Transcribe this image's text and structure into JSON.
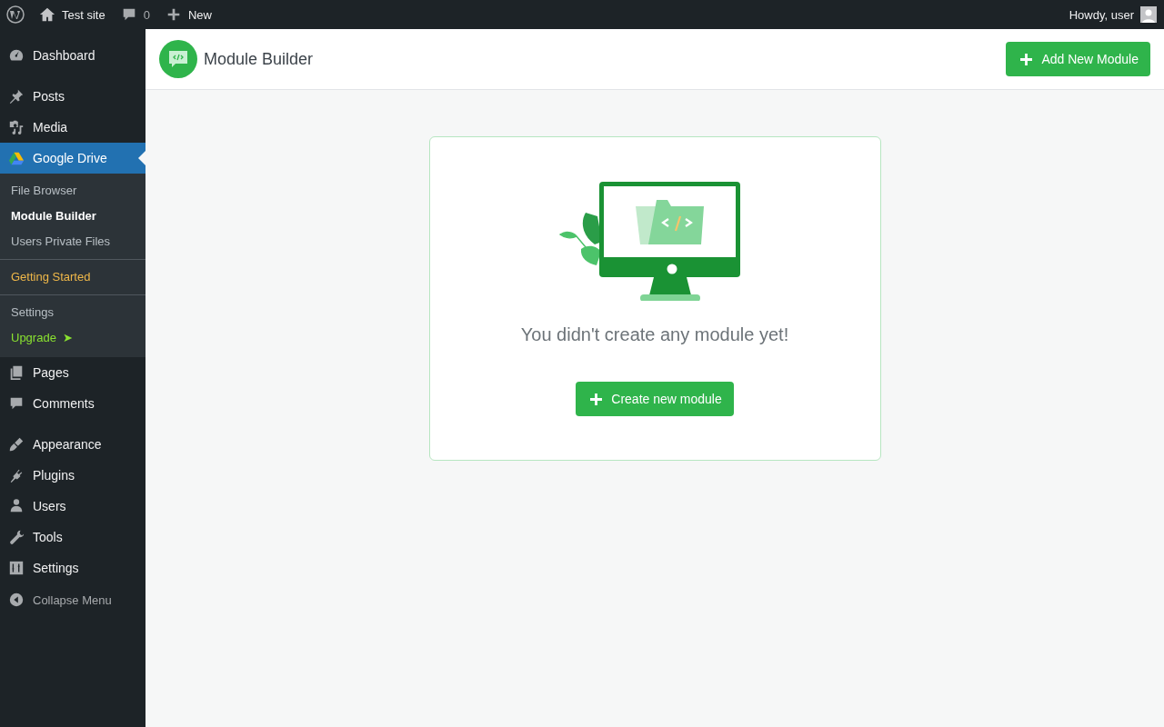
{
  "admin_bar": {
    "site": "Test site",
    "comments": "0",
    "new": "New",
    "greeting": "Howdy, user"
  },
  "sidebar": {
    "groups": [
      [
        {
          "label": "Dashboard",
          "selected": false
        }
      ],
      [
        {
          "label": "Posts",
          "selected": false
        },
        {
          "label": "Media",
          "selected": false
        },
        {
          "label": "Google Drive",
          "selected": true,
          "submenu": [
            [
              {
                "label": "File Browser",
                "kind": "plain",
                "selected": false
              },
              {
                "label": "Module Builder",
                "kind": "plain",
                "selected": true
              },
              {
                "label": "Users Private Files",
                "kind": "plain",
                "selected": false
              }
            ],
            [
              {
                "label": "Getting Started",
                "kind": "promo",
                "selected": false
              }
            ],
            [
              {
                "label": "Settings",
                "kind": "plain",
                "selected": false
              },
              {
                "label": "Upgrade",
                "kind": "upgrade",
                "arrow": "➤",
                "selected": false
              }
            ]
          ]
        },
        {
          "label": "Pages",
          "selected": false
        },
        {
          "label": "Comments",
          "selected": false
        }
      ],
      [
        {
          "label": "Appearance",
          "selected": false
        },
        {
          "label": "Plugins",
          "selected": false
        },
        {
          "label": "Users",
          "selected": false
        },
        {
          "label": "Tools",
          "selected": false
        },
        {
          "label": "Settings",
          "selected": false
        }
      ]
    ],
    "collapse": "Collapse Menu"
  },
  "header": {
    "title": "Module Builder",
    "add_button": "Add New Module"
  },
  "empty_state": {
    "message": "You didn't create any module yet!",
    "create_button": "Create new module"
  }
}
